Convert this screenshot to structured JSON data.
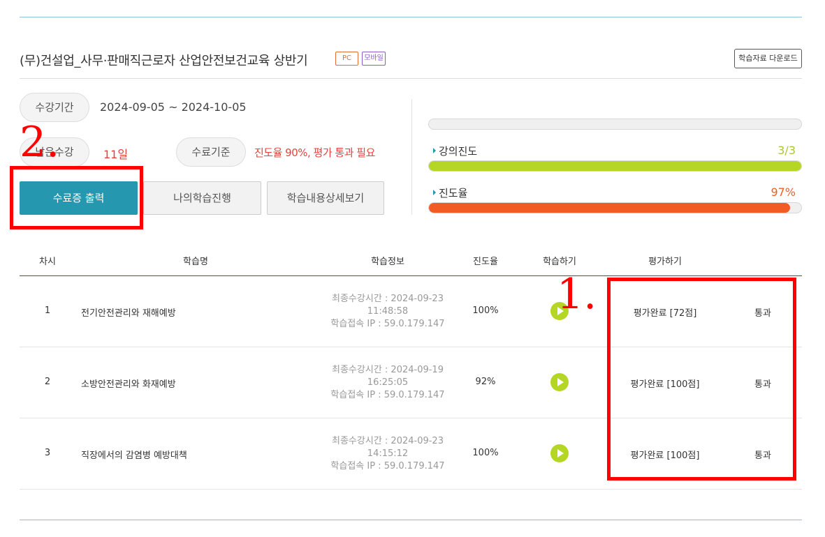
{
  "course": {
    "title": "(무)건설업_사무·판매직근로자 산업안전보건교육 상반기",
    "badges": [
      "PC",
      "모바일"
    ],
    "download_label": "학습자료 다운로드"
  },
  "summary": {
    "period_label": "수강기간",
    "period_value": "2024-09-05 ~ 2024-10-05",
    "remaining_label": "남은수강",
    "remaining_value": "11일",
    "criteria_label": "수료기준",
    "criteria_value": "진도율 90%, 평가 통과 필요"
  },
  "buttons": {
    "certificate": "수료증 출력",
    "my_progress": "나의학습진행",
    "detail": "학습내용상세보기"
  },
  "progress": {
    "lecture_label": "강의진도",
    "lecture_value": "3/3",
    "lecture_fraction": 1.0,
    "rate_label": "진도율",
    "rate_value": "97%",
    "rate_fraction": 0.97,
    "colors": {
      "lecture": "#b6d625",
      "rate": "#f25c24",
      "accent": "#2597ae"
    }
  },
  "table": {
    "headers": [
      "차시",
      "학습명",
      "학습정보",
      "진도율",
      "학습하기",
      "평가하기"
    ],
    "rows": [
      {
        "num": "1",
        "name": "전기안전관리와 재해예방",
        "info_line1": "최종수강시간 : 2024-09-23",
        "info_line2": "11:48:58",
        "info_line3": "학습접속 IP : 59.0.179.147",
        "rate": "100%",
        "eval": "평가완료 [72점]",
        "result": "통과"
      },
      {
        "num": "2",
        "name": "소방안전관리와 화재예방",
        "info_line1": "최종수강시간 : 2024-09-19",
        "info_line2": "16:25:05",
        "info_line3": "학습접속 IP : 59.0.179.147",
        "rate": "92%",
        "eval": "평가완료 [100점]",
        "result": "통과"
      },
      {
        "num": "3",
        "name": "직장에서의 감염병 예방대책",
        "info_line1": "최종수강시간 : 2024-09-23",
        "info_line2": "14:15:12",
        "info_line3": "학습접속 IP : 59.0.179.147",
        "rate": "100%",
        "eval": "평가완료 [100점]",
        "result": "통과"
      }
    ]
  },
  "annotations": {
    "label_1": "1.",
    "label_2": "2.",
    "color": "#ff0000"
  }
}
